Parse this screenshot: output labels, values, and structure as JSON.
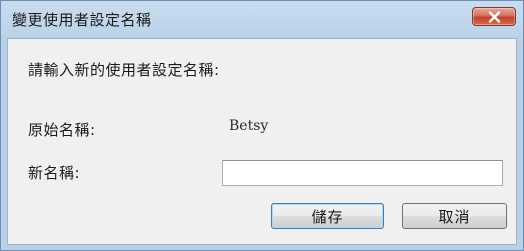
{
  "window": {
    "title": "變更使用者設定名稱",
    "close_icon": "close-icon"
  },
  "form": {
    "prompt": "請輸入新的使用者設定名稱:",
    "original_name_label": "原始名稱:",
    "original_name_value": "Betsy",
    "new_name_label": "新名稱:",
    "new_name_value": ""
  },
  "buttons": {
    "save_label": "儲存",
    "cancel_label": "取消"
  },
  "colors": {
    "titlebar": "#bcd3ea",
    "close_button": "#c2412a",
    "client_background": "#f0f0f0",
    "default_button_border": "#3c7fb1"
  }
}
